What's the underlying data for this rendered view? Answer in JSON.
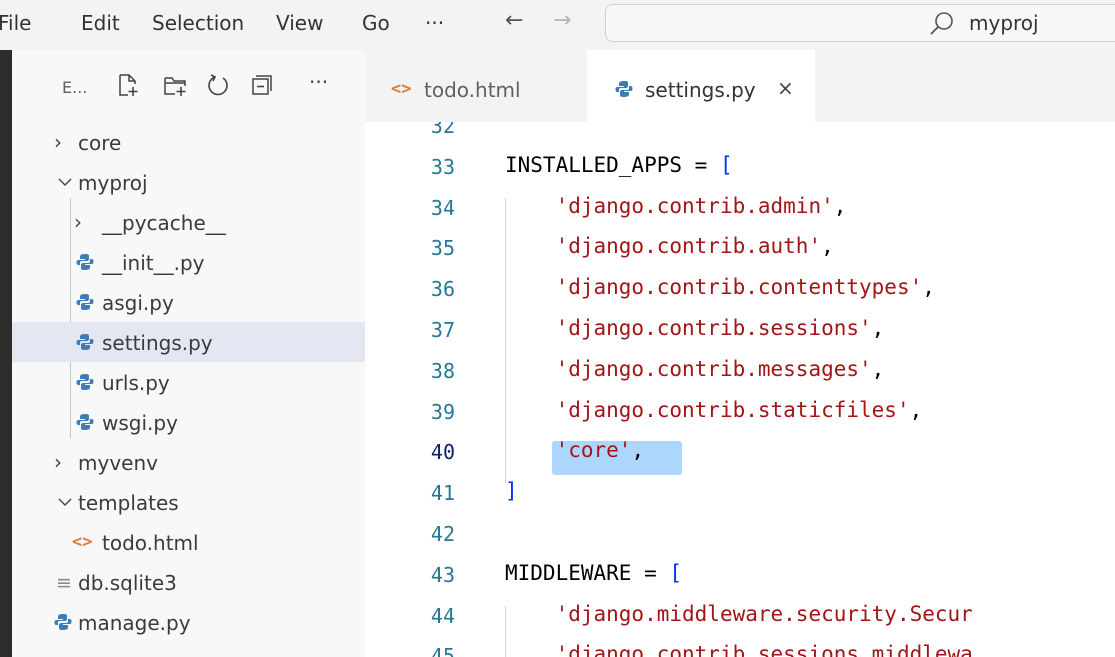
{
  "menubar": {
    "items": [
      "File",
      "Edit",
      "Selection",
      "View",
      "Go",
      "···"
    ],
    "search_text": "myproj"
  },
  "sidebar": {
    "title": "E...",
    "tree": [
      {
        "label": "core",
        "kind": "folder",
        "state": "collapsed"
      },
      {
        "label": "myproj",
        "kind": "folder",
        "state": "expanded"
      },
      {
        "label": "__pycache__",
        "kind": "folder",
        "state": "collapsed"
      },
      {
        "label": "__init__.py",
        "kind": "python"
      },
      {
        "label": "asgi.py",
        "kind": "python"
      },
      {
        "label": "settings.py",
        "kind": "python",
        "selected": true
      },
      {
        "label": "urls.py",
        "kind": "python"
      },
      {
        "label": "wsgi.py",
        "kind": "python"
      },
      {
        "label": "myvenv",
        "kind": "folder",
        "state": "collapsed"
      },
      {
        "label": "templates",
        "kind": "folder",
        "state": "expanded"
      },
      {
        "label": "todo.html",
        "kind": "html"
      },
      {
        "label": "db.sqlite3",
        "kind": "database"
      },
      {
        "label": "manage.py",
        "kind": "python"
      }
    ]
  },
  "tabs": [
    {
      "label": "todo.html",
      "active": false
    },
    {
      "label": "settings.py",
      "active": true,
      "close": "×"
    }
  ],
  "editor": {
    "lines": [
      {
        "num": "32",
        "text": ""
      },
      {
        "num": "33",
        "text": "INSTALLED_APPS = ["
      },
      {
        "num": "34",
        "text": "    'django.contrib.admin',"
      },
      {
        "num": "35",
        "text": "    'django.contrib.auth',"
      },
      {
        "num": "36",
        "text": "    'django.contrib.contenttypes',"
      },
      {
        "num": "37",
        "text": "    'django.contrib.sessions',"
      },
      {
        "num": "38",
        "text": "    'django.contrib.messages',"
      },
      {
        "num": "39",
        "text": "    'django.contrib.staticfiles',"
      },
      {
        "num": "40",
        "text": "    'core',",
        "current": true
      },
      {
        "num": "41",
        "text": "]"
      },
      {
        "num": "42",
        "text": ""
      },
      {
        "num": "43",
        "text": "MIDDLEWARE = ["
      },
      {
        "num": "44",
        "text": "    'django.middleware.security.Secur"
      },
      {
        "num": "45",
        "text": "    'django.contrib.sessions.middlewa"
      }
    ]
  },
  "colors": {
    "string": "#a31515",
    "bracket": "#0431fa",
    "line_number": "#237893",
    "selection": "#add6ff",
    "selected_row": "#e4e6f1"
  }
}
